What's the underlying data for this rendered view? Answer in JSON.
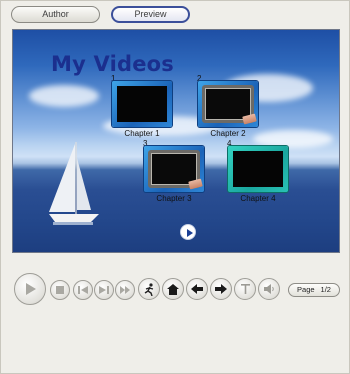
{
  "modes": {
    "author_label": "Author",
    "preview_label": "Preview"
  },
  "preview": {
    "menu_title": "My Videos",
    "chapters": [
      {
        "number": "1",
        "label": "Chapter 1",
        "style": "blue"
      },
      {
        "number": "2",
        "label": "Chapter 2",
        "style": "decorated"
      },
      {
        "number": "3",
        "label": "Chapter 3",
        "style": "decorated"
      },
      {
        "number": "4",
        "label": "Chapter 4",
        "style": "teal"
      }
    ],
    "play_icon": "play-circle-icon"
  },
  "controls": {
    "buttons": [
      {
        "name": "play-button",
        "icon": "play-icon"
      },
      {
        "name": "stop-button",
        "icon": "stop-icon"
      },
      {
        "name": "previous-chapter-button",
        "icon": "skip-back-icon"
      },
      {
        "name": "next-chapter-button",
        "icon": "skip-forward-icon"
      },
      {
        "name": "fast-forward-button",
        "icon": "fast-forward-icon"
      },
      {
        "name": "exit-button",
        "icon": "running-man-icon"
      },
      {
        "name": "menu-home-button",
        "icon": "home-icon"
      },
      {
        "name": "back-arrow-button",
        "icon": "arrow-left-icon"
      },
      {
        "name": "forward-arrow-button",
        "icon": "arrow-right-icon"
      },
      {
        "name": "title-button",
        "icon": "title-t-icon"
      },
      {
        "name": "audio-button",
        "icon": "speaker-icon"
      }
    ],
    "page_label": "Page",
    "page_value": "1/2"
  },
  "colors": {
    "title_blue": "#1b2f8e",
    "preview_border": "#3b4f9a",
    "chapter_frame_blue": "#1b63b8",
    "chapter_frame_teal": "#1aa79f"
  }
}
